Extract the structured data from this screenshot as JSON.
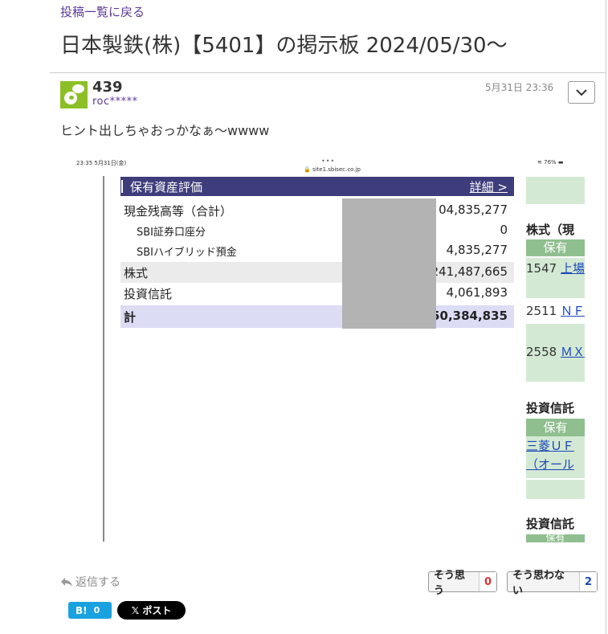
{
  "nav": {
    "back_label": "投稿一覧に戻る"
  },
  "page": {
    "title": "日本製鉄(株)【5401】の掲示板 2024/05/30〜"
  },
  "post": {
    "number": "439",
    "user_id": "roc*****",
    "timestamp": "5月31日 23:36",
    "body": "ヒント出しちゃおっかなぁ～wwww"
  },
  "screenshot": {
    "status_time": "23:35  5月31日(金)",
    "status_dots": "•••",
    "status_url": "🔒 site1.sbisec.co.jp",
    "status_battery": "76%",
    "table_title": "保有資産評価",
    "detail_link": "詳細 >",
    "rows": [
      {
        "label": "現金残高等（合計）",
        "value": "04,835,277"
      },
      {
        "label": "SBI証券口座分",
        "value": "0"
      },
      {
        "label": "SBIハイブリッド預金",
        "value": "4,835,277"
      },
      {
        "label": "株式",
        "value": "241,487,665"
      },
      {
        "label": "投資信託",
        "value": "4,061,893"
      },
      {
        "label": "計",
        "value": "50,384,835"
      }
    ],
    "right_panel": {
      "stocks_heading": "株式（現",
      "stocks_sub": "保有",
      "stock_items": [
        {
          "code": "1547",
          "name": "上場"
        },
        {
          "code": "2511",
          "name": "ＮＦ"
        },
        {
          "code": "2558",
          "name": "ＭＸ"
        }
      ],
      "funds_heading": "投資信託",
      "funds_sub": "保有",
      "fund_name_1": "三菱ＵＦ",
      "fund_name_2": "（オール",
      "funds_heading_2": "投資信託",
      "funds_sub_2": "保有"
    }
  },
  "actions": {
    "reply_label": "返信する",
    "agree_label": "そう思う",
    "agree_count": "0",
    "disagree_label": "そう思わない",
    "disagree_count": "2",
    "hatena_label": "B!",
    "hatena_count": "0",
    "x_post_label": "𝕏 ポスト"
  },
  "colors": {
    "link_purple": "#5b3a9a",
    "avatar_green": "#8cbf26",
    "table_header_navy": "#3e3d7b",
    "hatena_blue": "#1aa1e0"
  }
}
